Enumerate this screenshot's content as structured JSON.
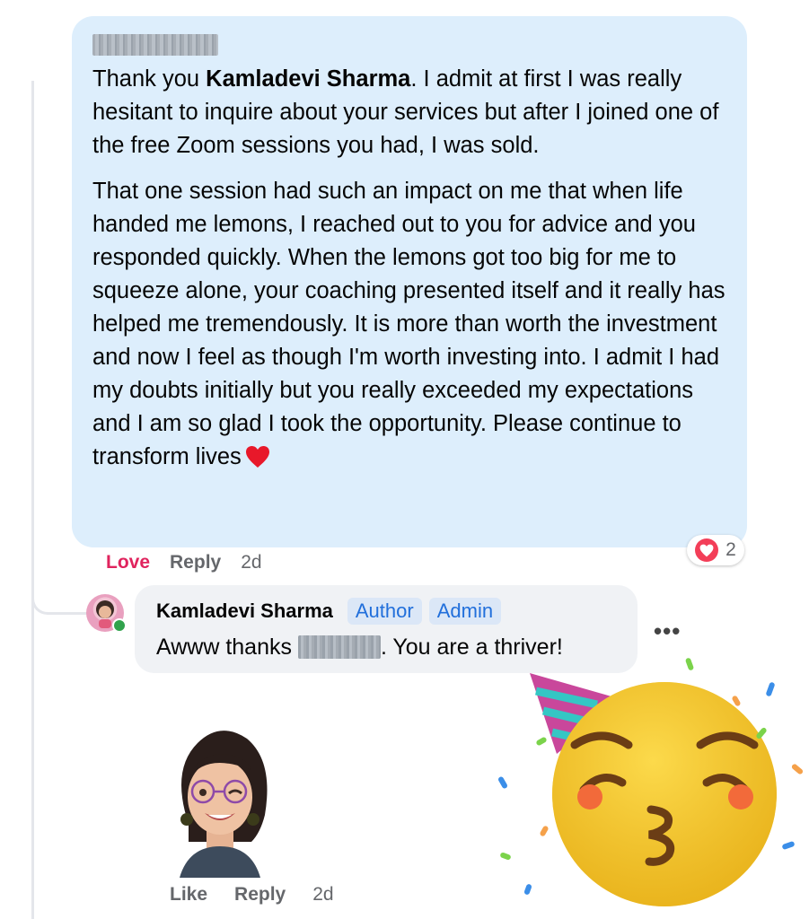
{
  "comment": {
    "paragraph1": {
      "prefix": "Thank you ",
      "mention": "Kamladevi Sharma",
      "suffix": ". I admit at first I was really hesitant to inquire about your services but after I joined one of the free Zoom sessions you had, I was sold."
    },
    "paragraph2": "That one session had such an impact on me that when life handed me lemons, I reached out to you for advice and you responded quickly. When the lemons got too big for me to squeeze alone, your coaching presented itself and it really has helped me tremendously. It is more than worth the investment and now I feel as though I'm worth investing into. I admit I had my doubts initially but you really exceeded my expectations and I am so glad I took the opportunity. Please continue to transform lives",
    "heart_emoji": "heart-icon",
    "actions": {
      "love": "Love",
      "reply": "Reply",
      "time": "2d"
    },
    "reaction_count": "2",
    "reaction_icon": "love-reaction-icon"
  },
  "reply": {
    "author": "Kamladevi Sharma",
    "badges": [
      "Author",
      "Admin"
    ],
    "text_before": "Awww thanks ",
    "text_after": ". You are a thriver!",
    "more_label": "•••",
    "actions": {
      "like": "Like",
      "reply": "Reply",
      "time": "2d"
    },
    "stickers": [
      "avatar-wink-sticker",
      "party-kiss-emoji-sticker"
    ]
  },
  "colors": {
    "comment_bubble": "#ddeefc",
    "reply_bubble": "#f0f2f5",
    "love": "#e0245e",
    "badge_text": "#216fdb",
    "badge_bg": "#dbe7f7",
    "meta_text": "#65676b"
  }
}
